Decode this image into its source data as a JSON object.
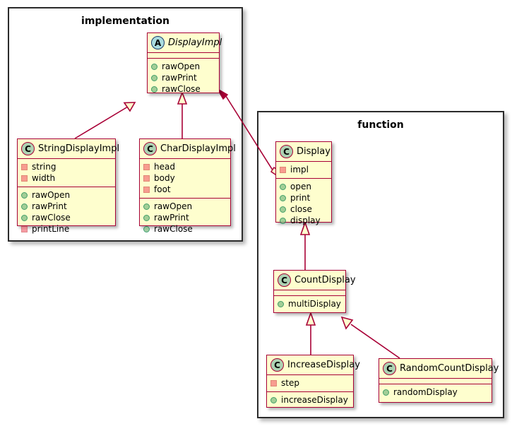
{
  "diagram": {
    "type": "uml-class-diagram",
    "colors": {
      "class_fill": "#FEFECE",
      "class_border": "#A80036",
      "package_border": "#2b2b2b",
      "link": "#A80036",
      "badge_class_fill": "#ADD1B2",
      "badge_abstract_fill": "#A9DCDF"
    }
  },
  "packages": [
    {
      "id": "implementation",
      "title": "implementation"
    },
    {
      "id": "function",
      "title": "function"
    }
  ],
  "classes": {
    "display_impl": {
      "name": "DisplayImpl",
      "stereotype": "A",
      "abstract": true,
      "fields": [],
      "methods": [
        {
          "name": "rawOpen",
          "visibility": "public"
        },
        {
          "name": "rawPrint",
          "visibility": "public"
        },
        {
          "name": "rawClose",
          "visibility": "public"
        }
      ]
    },
    "string_display_impl": {
      "name": "StringDisplayImpl",
      "stereotype": "C",
      "abstract": false,
      "fields": [
        {
          "name": "string",
          "visibility": "private"
        },
        {
          "name": "width",
          "visibility": "private"
        }
      ],
      "methods": [
        {
          "name": "rawOpen",
          "visibility": "public"
        },
        {
          "name": "rawPrint",
          "visibility": "public"
        },
        {
          "name": "rawClose",
          "visibility": "public"
        },
        {
          "name": "printLine",
          "visibility": "private"
        }
      ]
    },
    "char_display_impl": {
      "name": "CharDisplayImpl",
      "stereotype": "C",
      "abstract": false,
      "fields": [
        {
          "name": "head",
          "visibility": "private"
        },
        {
          "name": "body",
          "visibility": "private"
        },
        {
          "name": "foot",
          "visibility": "private"
        }
      ],
      "methods": [
        {
          "name": "rawOpen",
          "visibility": "public"
        },
        {
          "name": "rawPrint",
          "visibility": "public"
        },
        {
          "name": "rawClose",
          "visibility": "public"
        }
      ]
    },
    "display": {
      "name": "Display",
      "stereotype": "C",
      "abstract": false,
      "fields": [
        {
          "name": "impl",
          "visibility": "private"
        }
      ],
      "methods": [
        {
          "name": "open",
          "visibility": "public"
        },
        {
          "name": "print",
          "visibility": "public"
        },
        {
          "name": "close",
          "visibility": "public"
        },
        {
          "name": "display",
          "visibility": "public"
        }
      ]
    },
    "count_display": {
      "name": "CountDisplay",
      "stereotype": "C",
      "abstract": false,
      "fields": [],
      "methods": [
        {
          "name": "multiDisplay",
          "visibility": "public"
        }
      ]
    },
    "increase_display": {
      "name": "IncreaseDisplay",
      "stereotype": "C",
      "abstract": false,
      "fields": [
        {
          "name": "step",
          "visibility": "private"
        }
      ],
      "methods": [
        {
          "name": "increaseDisplay",
          "visibility": "public"
        }
      ]
    },
    "random_count_display": {
      "name": "RandomCountDisplay",
      "stereotype": "C",
      "abstract": false,
      "fields": [],
      "methods": [
        {
          "name": "randomDisplay",
          "visibility": "public"
        }
      ]
    }
  },
  "relationships": [
    {
      "from": "StringDisplayImpl",
      "to": "DisplayImpl",
      "kind": "generalization"
    },
    {
      "from": "CharDisplayImpl",
      "to": "DisplayImpl",
      "kind": "generalization"
    },
    {
      "from": "Display",
      "to": "DisplayImpl",
      "kind": "aggregation"
    },
    {
      "from": "CountDisplay",
      "to": "Display",
      "kind": "generalization"
    },
    {
      "from": "IncreaseDisplay",
      "to": "CountDisplay",
      "kind": "generalization"
    },
    {
      "from": "RandomCountDisplay",
      "to": "CountDisplay",
      "kind": "generalization"
    }
  ]
}
